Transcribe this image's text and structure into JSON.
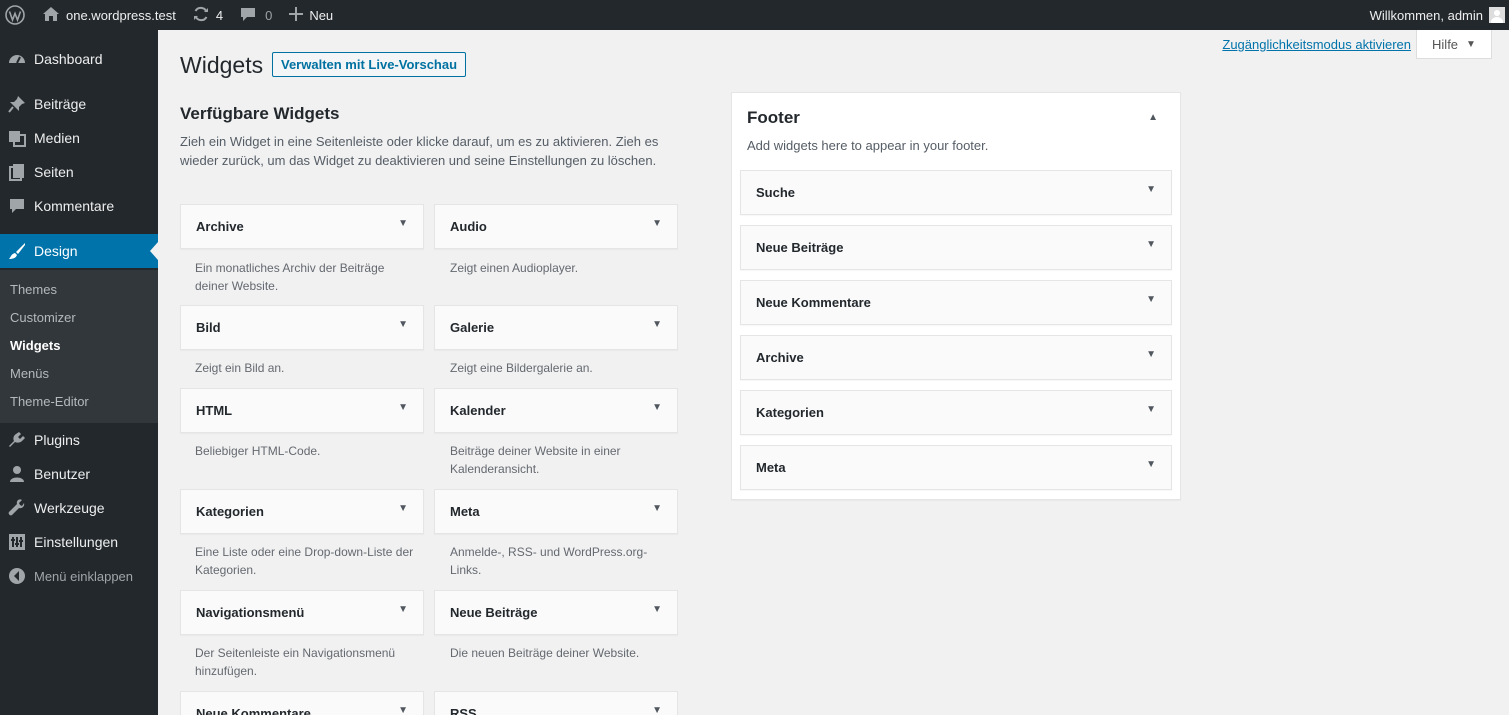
{
  "adminbar": {
    "site_name": "one.wordpress.test",
    "updates_count": "4",
    "comments_count": "0",
    "new_label": "Neu",
    "greeting": "Willkommen, admin"
  },
  "menu": {
    "dashboard": "Dashboard",
    "posts": "Beiträge",
    "media": "Medien",
    "pages": "Seiten",
    "comments": "Kommentare",
    "design": "Design",
    "plugins": "Plugins",
    "users": "Benutzer",
    "tools": "Werkzeuge",
    "settings": "Einstellungen",
    "collapse": "Menü einklappen",
    "submenu": [
      "Themes",
      "Customizer",
      "Widgets",
      "Menüs",
      "Theme-Editor"
    ]
  },
  "header": {
    "title": "Widgets",
    "live_preview_button": "Verwalten mit Live-Vorschau",
    "a11y_link": "Zugänglichkeitsmodus aktivieren",
    "help_tab": "Hilfe"
  },
  "available": {
    "heading": "Verfügbare Widgets",
    "description": "Zieh ein Widget in eine Seitenleiste oder klicke darauf, um es zu aktivieren. Zieh es wieder zurück, um das Widget zu deaktivieren und seine Einstellungen zu löschen.",
    "widgets": [
      {
        "title": "Archive",
        "desc": "Ein monatliches Archiv der Beiträge deiner Website."
      },
      {
        "title": "Audio",
        "desc": "Zeigt einen Audioplayer."
      },
      {
        "title": "Bild",
        "desc": "Zeigt ein Bild an."
      },
      {
        "title": "Galerie",
        "desc": "Zeigt eine Bildergalerie an."
      },
      {
        "title": "HTML",
        "desc": "Beliebiger HTML-Code."
      },
      {
        "title": "Kalender",
        "desc": "Beiträge deiner Website in einer Kalenderansicht."
      },
      {
        "title": "Kategorien",
        "desc": "Eine Liste oder eine Drop-down-Liste der Kategorien."
      },
      {
        "title": "Meta",
        "desc": "Anmelde-, RSS- und WordPress.org-Links."
      },
      {
        "title": "Navigationsmenü",
        "desc": "Der Seitenleiste ein Navigationsmenü hinzufügen."
      },
      {
        "title": "Neue Beiträge",
        "desc": "Die neuen Beiträge deiner Website."
      },
      {
        "title": "Neue Kommentare",
        "desc": ""
      },
      {
        "title": "RSS",
        "desc": ""
      }
    ]
  },
  "footer_sidebar": {
    "title": "Footer",
    "description": "Add widgets here to appear in your footer.",
    "widgets": [
      "Suche",
      "Neue Beiträge",
      "Neue Kommentare",
      "Archive",
      "Kategorien",
      "Meta"
    ]
  }
}
